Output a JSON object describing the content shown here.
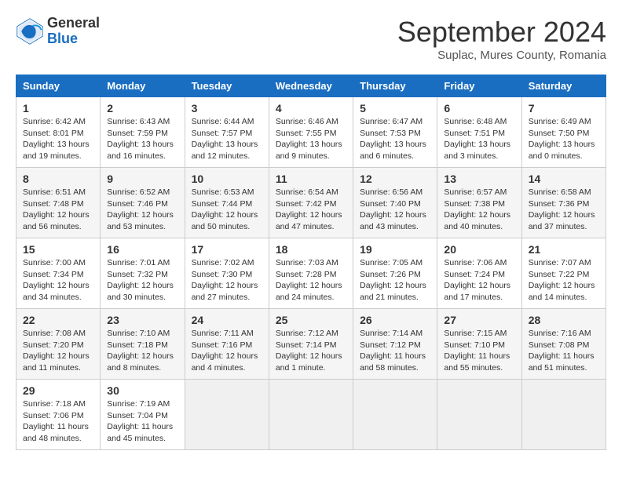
{
  "header": {
    "logo_general": "General",
    "logo_blue": "Blue",
    "title": "September 2024",
    "subtitle": "Suplac, Mures County, Romania"
  },
  "columns": [
    "Sunday",
    "Monday",
    "Tuesday",
    "Wednesday",
    "Thursday",
    "Friday",
    "Saturday"
  ],
  "weeks": [
    [
      {
        "day": "1",
        "sunrise": "6:42 AM",
        "sunset": "8:01 PM",
        "daylight": "13 hours and 19 minutes."
      },
      {
        "day": "2",
        "sunrise": "6:43 AM",
        "sunset": "7:59 PM",
        "daylight": "13 hours and 16 minutes."
      },
      {
        "day": "3",
        "sunrise": "6:44 AM",
        "sunset": "7:57 PM",
        "daylight": "13 hours and 12 minutes."
      },
      {
        "day": "4",
        "sunrise": "6:46 AM",
        "sunset": "7:55 PM",
        "daylight": "13 hours and 9 minutes."
      },
      {
        "day": "5",
        "sunrise": "6:47 AM",
        "sunset": "7:53 PM",
        "daylight": "13 hours and 6 minutes."
      },
      {
        "day": "6",
        "sunrise": "6:48 AM",
        "sunset": "7:51 PM",
        "daylight": "13 hours and 3 minutes."
      },
      {
        "day": "7",
        "sunrise": "6:49 AM",
        "sunset": "7:50 PM",
        "daylight": "13 hours and 0 minutes."
      }
    ],
    [
      {
        "day": "8",
        "sunrise": "6:51 AM",
        "sunset": "7:48 PM",
        "daylight": "12 hours and 56 minutes."
      },
      {
        "day": "9",
        "sunrise": "6:52 AM",
        "sunset": "7:46 PM",
        "daylight": "12 hours and 53 minutes."
      },
      {
        "day": "10",
        "sunrise": "6:53 AM",
        "sunset": "7:44 PM",
        "daylight": "12 hours and 50 minutes."
      },
      {
        "day": "11",
        "sunrise": "6:54 AM",
        "sunset": "7:42 PM",
        "daylight": "12 hours and 47 minutes."
      },
      {
        "day": "12",
        "sunrise": "6:56 AM",
        "sunset": "7:40 PM",
        "daylight": "12 hours and 43 minutes."
      },
      {
        "day": "13",
        "sunrise": "6:57 AM",
        "sunset": "7:38 PM",
        "daylight": "12 hours and 40 minutes."
      },
      {
        "day": "14",
        "sunrise": "6:58 AM",
        "sunset": "7:36 PM",
        "daylight": "12 hours and 37 minutes."
      }
    ],
    [
      {
        "day": "15",
        "sunrise": "7:00 AM",
        "sunset": "7:34 PM",
        "daylight": "12 hours and 34 minutes."
      },
      {
        "day": "16",
        "sunrise": "7:01 AM",
        "sunset": "7:32 PM",
        "daylight": "12 hours and 30 minutes."
      },
      {
        "day": "17",
        "sunrise": "7:02 AM",
        "sunset": "7:30 PM",
        "daylight": "12 hours and 27 minutes."
      },
      {
        "day": "18",
        "sunrise": "7:03 AM",
        "sunset": "7:28 PM",
        "daylight": "12 hours and 24 minutes."
      },
      {
        "day": "19",
        "sunrise": "7:05 AM",
        "sunset": "7:26 PM",
        "daylight": "12 hours and 21 minutes."
      },
      {
        "day": "20",
        "sunrise": "7:06 AM",
        "sunset": "7:24 PM",
        "daylight": "12 hours and 17 minutes."
      },
      {
        "day": "21",
        "sunrise": "7:07 AM",
        "sunset": "7:22 PM",
        "daylight": "12 hours and 14 minutes."
      }
    ],
    [
      {
        "day": "22",
        "sunrise": "7:08 AM",
        "sunset": "7:20 PM",
        "daylight": "12 hours and 11 minutes."
      },
      {
        "day": "23",
        "sunrise": "7:10 AM",
        "sunset": "7:18 PM",
        "daylight": "12 hours and 8 minutes."
      },
      {
        "day": "24",
        "sunrise": "7:11 AM",
        "sunset": "7:16 PM",
        "daylight": "12 hours and 4 minutes."
      },
      {
        "day": "25",
        "sunrise": "7:12 AM",
        "sunset": "7:14 PM",
        "daylight": "12 hours and 1 minute."
      },
      {
        "day": "26",
        "sunrise": "7:14 AM",
        "sunset": "7:12 PM",
        "daylight": "11 hours and 58 minutes."
      },
      {
        "day": "27",
        "sunrise": "7:15 AM",
        "sunset": "7:10 PM",
        "daylight": "11 hours and 55 minutes."
      },
      {
        "day": "28",
        "sunrise": "7:16 AM",
        "sunset": "7:08 PM",
        "daylight": "11 hours and 51 minutes."
      }
    ],
    [
      {
        "day": "29",
        "sunrise": "7:18 AM",
        "sunset": "7:06 PM",
        "daylight": "11 hours and 48 minutes."
      },
      {
        "day": "30",
        "sunrise": "7:19 AM",
        "sunset": "7:04 PM",
        "daylight": "11 hours and 45 minutes."
      },
      null,
      null,
      null,
      null,
      null
    ]
  ],
  "labels": {
    "sunrise": "Sunrise:",
    "sunset": "Sunset:",
    "daylight": "Daylight hours"
  }
}
